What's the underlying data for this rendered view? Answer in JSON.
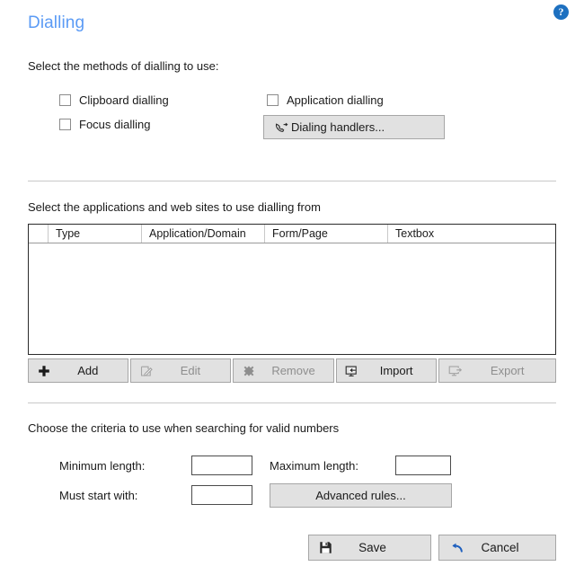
{
  "header": {
    "title": "Dialling",
    "help_icon": "help-question-icon",
    "help_glyph": "?",
    "title_color": "#5b9bf5",
    "help_color": "#1d70c0"
  },
  "methods_section": {
    "label": "Select the methods of dialling to use:",
    "checkboxes": [
      {
        "label": "Clipboard dialling",
        "checked": false
      },
      {
        "label": "Focus dialling",
        "checked": false
      },
      {
        "label": "Application dialling",
        "checked": false
      }
    ],
    "dialing_handlers_button": {
      "label": "Dialing handlers...",
      "icon": "phone-handset-outgoing-icon",
      "enabled": true
    }
  },
  "applications_section": {
    "label": "Select the applications and web sites to use dialling from",
    "table": {
      "columns": [
        "",
        "Type",
        "Application/Domain",
        "Form/Page",
        "Textbox"
      ],
      "rows": []
    },
    "toolbar": [
      {
        "label": "Add",
        "icon": "plus-icon",
        "enabled": true
      },
      {
        "label": "Edit",
        "icon": "pencil-edit-icon",
        "enabled": false
      },
      {
        "label": "Remove",
        "icon": "cross-remove-icon",
        "enabled": false
      },
      {
        "label": "Import",
        "icon": "monitor-import-icon",
        "enabled": true
      },
      {
        "label": "Export",
        "icon": "monitor-export-icon",
        "enabled": false
      }
    ]
  },
  "criteria_section": {
    "label": "Choose the criteria to use when searching for valid numbers",
    "fields": [
      {
        "label": "Minimum length:",
        "value": "",
        "placeholder": ""
      },
      {
        "label": "Maximum length:",
        "value": "",
        "placeholder": ""
      },
      {
        "label": "Must start with:",
        "value": "",
        "placeholder": ""
      }
    ],
    "advanced_rules_button": {
      "label": "Advanced rules...",
      "enabled": true
    }
  },
  "footer": {
    "save_button": {
      "label": "Save",
      "icon": "floppy-save-icon",
      "enabled": true
    },
    "cancel_button": {
      "label": "Cancel",
      "icon": "back-arrow-icon",
      "enabled": true,
      "icon_color": "#1e5fbe"
    }
  }
}
